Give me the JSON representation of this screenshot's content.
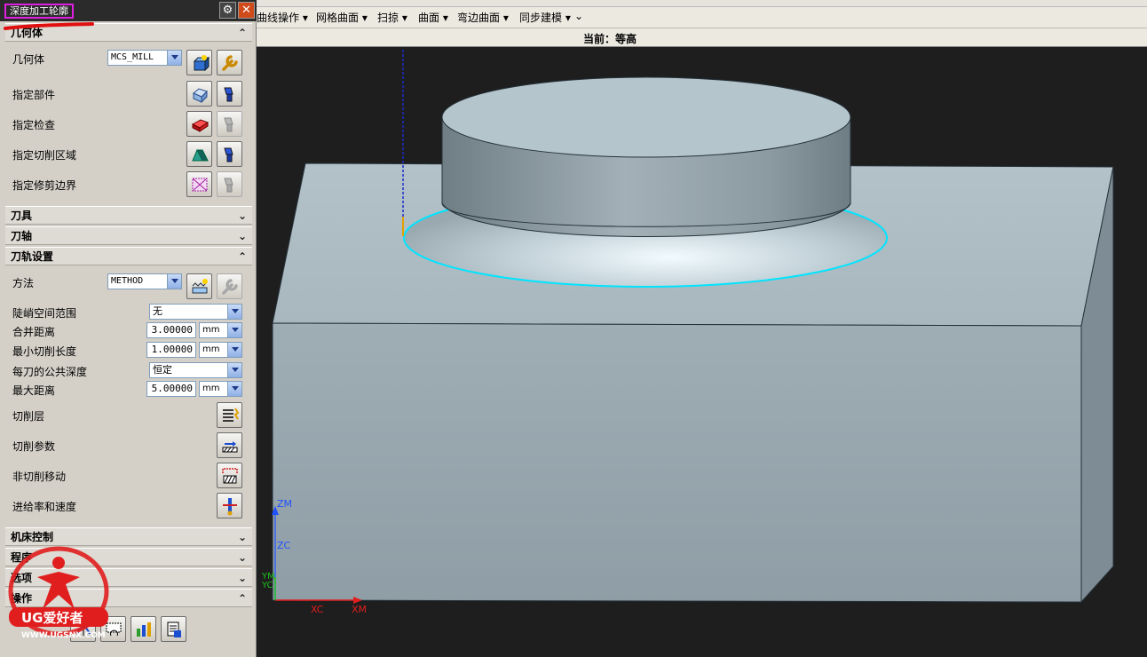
{
  "dialog": {
    "title": "深度加工轮廓",
    "gear_label": "⚙",
    "close_label": "✕"
  },
  "sections": {
    "geometry": "几何体",
    "tool": "刀具",
    "axis": "刀轴",
    "path_settings": "刀轨设置",
    "machine_control": "机床控制",
    "program": "程序",
    "options": "选项",
    "actions": "操作"
  },
  "geometry": {
    "geometry_label": "几何体",
    "geometry_value": "MCS_MILL",
    "specify_part": "指定部件",
    "specify_check": "指定检查",
    "specify_cut_area": "指定切削区域",
    "specify_trim": "指定修剪边界"
  },
  "path": {
    "method_label": "方法",
    "method_value": "METHOD",
    "steep_label": "陡峭空间范围",
    "steep_value": "无",
    "merge_label": "合并距离",
    "merge_value": "3.00000",
    "merge_unit": "mm",
    "mincut_label": "最小切削长度",
    "mincut_value": "1.00000",
    "mincut_unit": "mm",
    "depth_label": "每刀的公共深度",
    "depth_value": "恒定",
    "maxdist_label": "最大距离",
    "maxdist_value": "5.00000",
    "maxdist_unit": "mm",
    "cut_levels": "切削层",
    "cut_params": "切削参数",
    "non_cut_moves": "非切削移动",
    "feeds_speeds": "进给率和速度"
  },
  "menubar": {
    "items": [
      "曲线操作 ▾",
      "网格曲面 ▾",
      "扫掠 ▾",
      "曲面 ▾",
      "弯边曲面 ▾",
      "同步建模 ▾"
    ],
    "more": "⌄"
  },
  "status": {
    "text": "当前：等高"
  },
  "axes": {
    "zm": "ZM",
    "zc": "ZC",
    "ym": "YM",
    "yc": "YC",
    "xc": "XC",
    "xm": "XM"
  },
  "watermark": {
    "brand": "UG爱好者",
    "url": "WWW.UGSNX.COM"
  },
  "colors": {
    "accent_highlight": "#e020e0",
    "close_button": "#d04a1a",
    "selection_curve": "#00e5ff",
    "model_gray": "#a9b7bf"
  }
}
